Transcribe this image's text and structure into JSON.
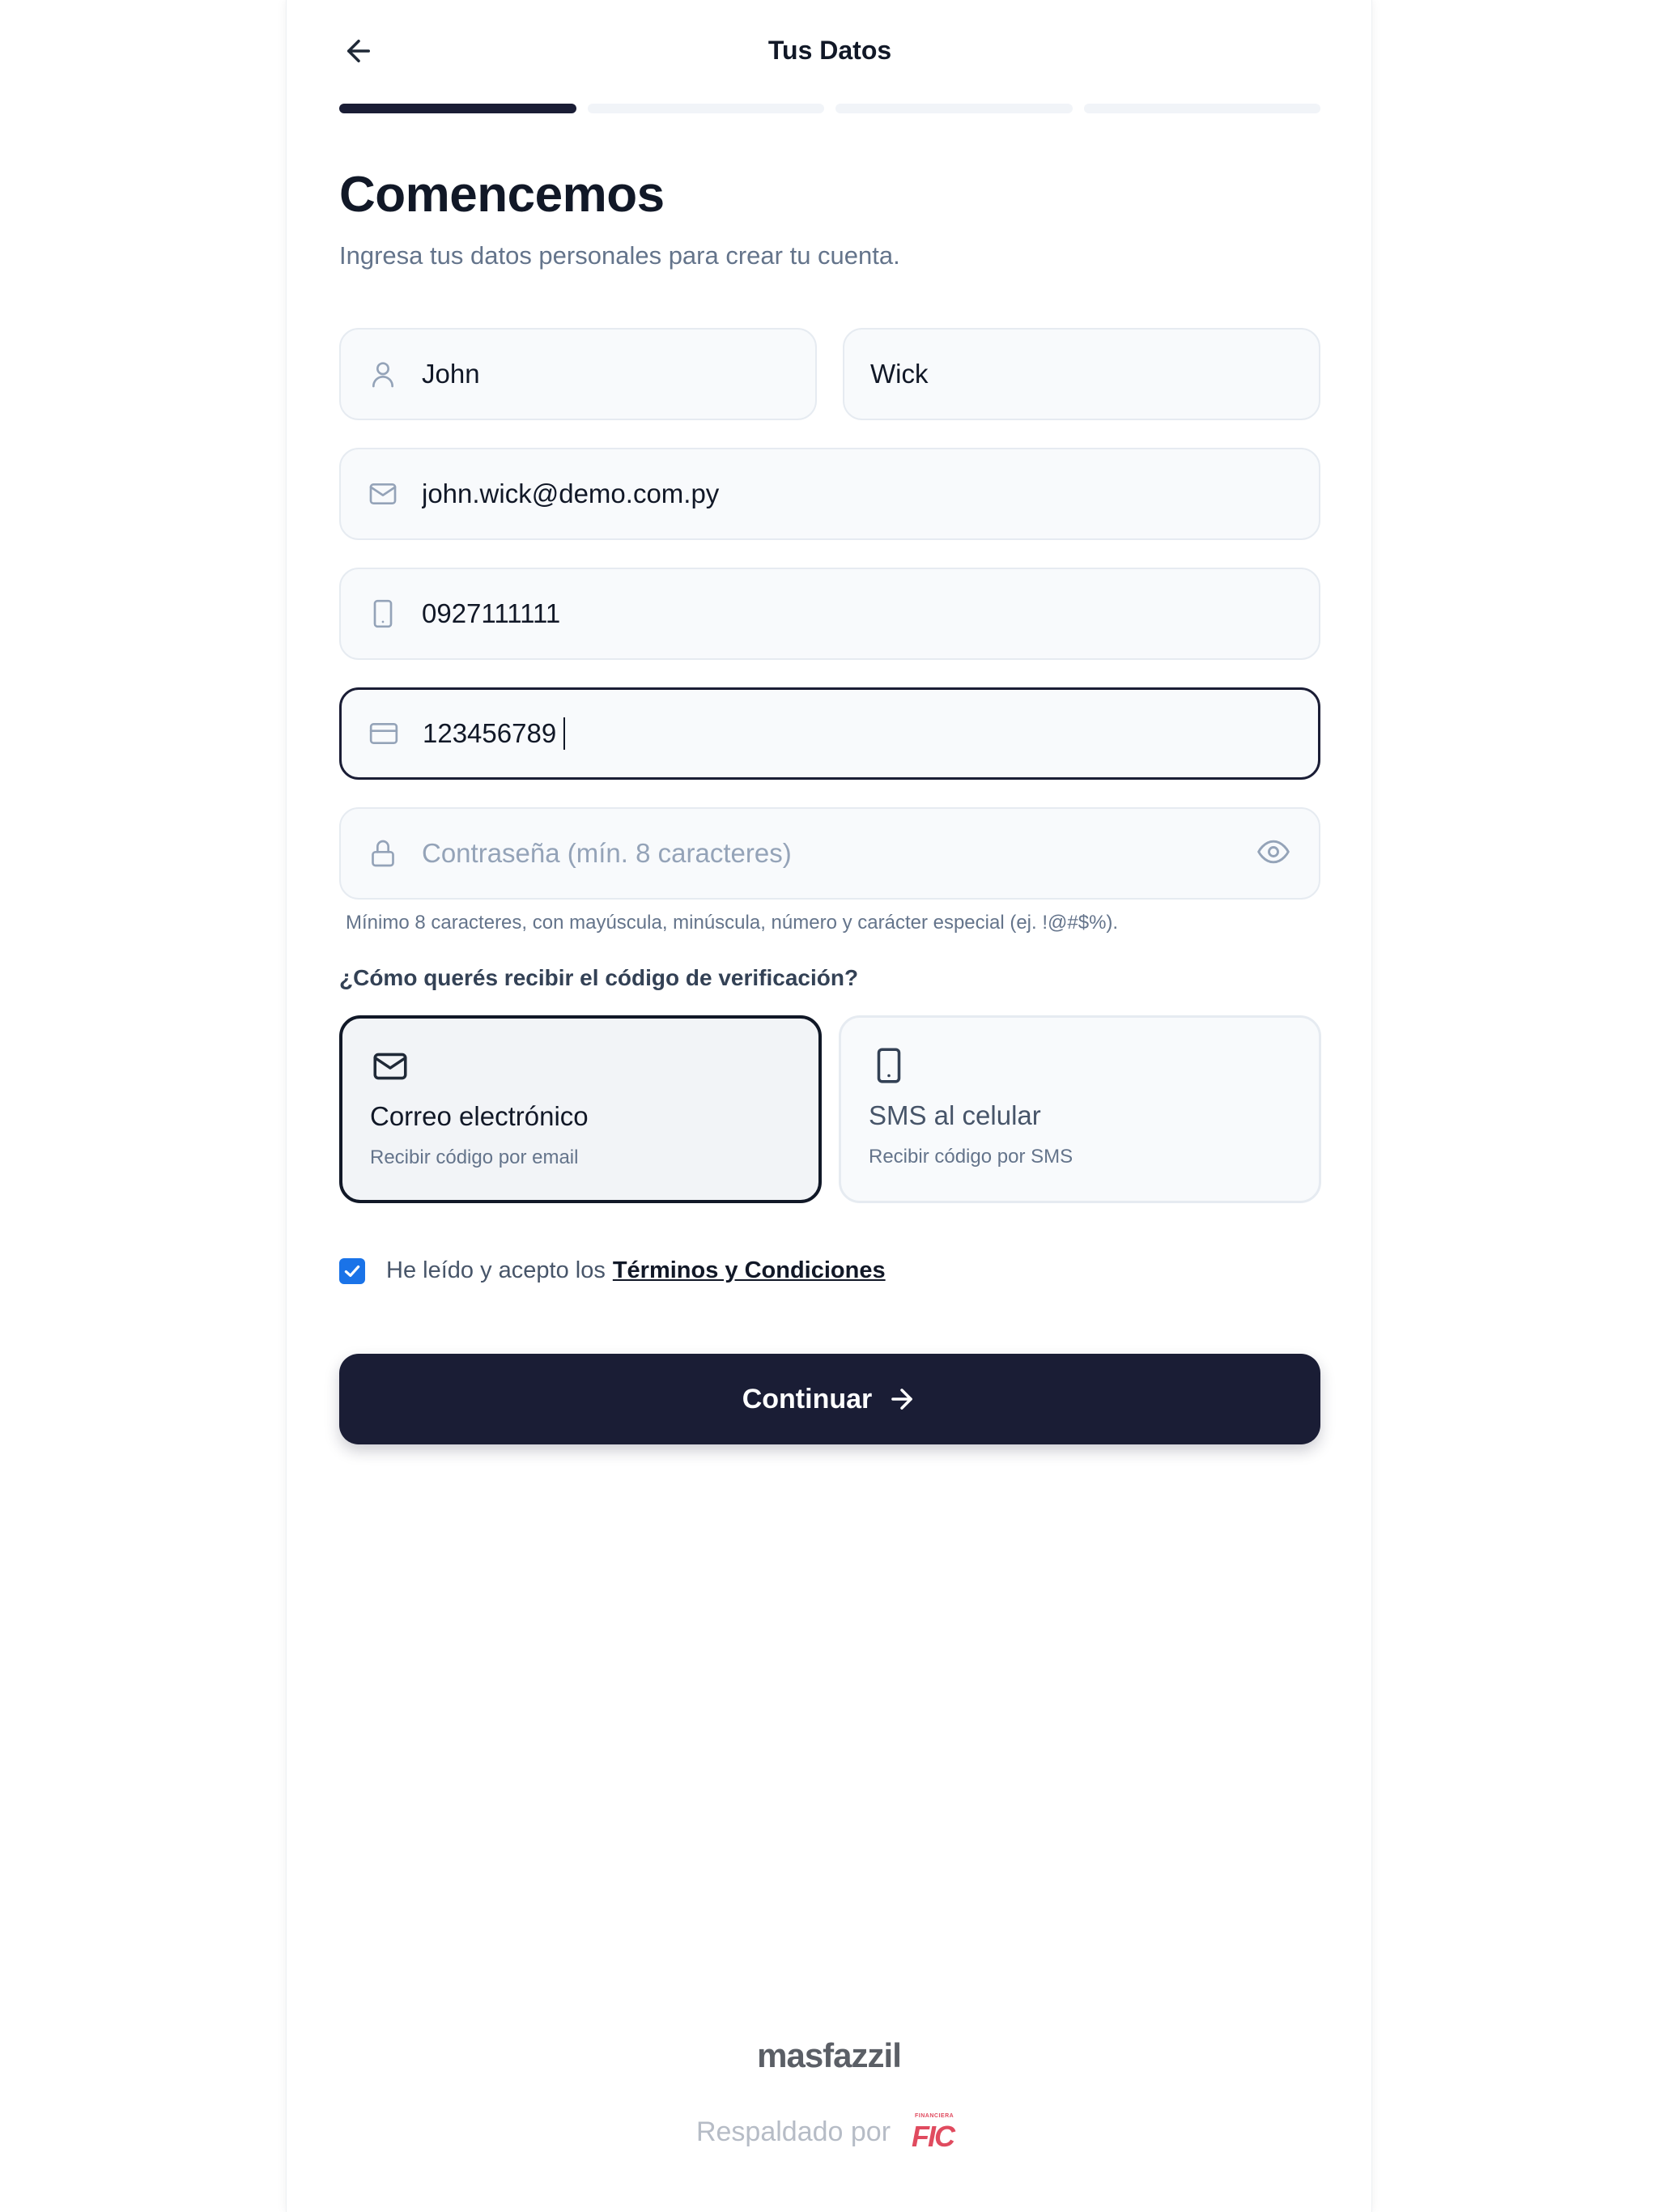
{
  "header": {
    "title": "Tus Datos",
    "back_icon": "arrow-left-icon"
  },
  "progress": {
    "current_step": 1,
    "total_steps": 4
  },
  "intro": {
    "title": "Comencemos",
    "subtitle": "Ingresa tus datos personales para crear tu cuenta."
  },
  "form": {
    "first_name": {
      "value": "John",
      "icon": "user-icon"
    },
    "last_name": {
      "value": "Wick"
    },
    "email": {
      "value": "john.wick@demo.com.py",
      "icon": "mail-icon"
    },
    "phone": {
      "value": "0927111111",
      "icon": "phone-icon"
    },
    "document": {
      "value": "123456789",
      "icon": "id-card-icon"
    },
    "password": {
      "value": "",
      "placeholder": "Contraseña (mín. 8 caracteres)",
      "icon": "lock-icon",
      "toggle_icon": "eye-icon"
    },
    "password_hint": "Mínimo 8 caracteres, con mayúscula, minúscula, número y carácter especial (ej. !@#$%)."
  },
  "verification": {
    "question": "¿Cómo querés recibir el código de verificación?",
    "options": [
      {
        "title": "Correo electrónico",
        "subtitle": "Recibir código por email",
        "icon": "mail-icon",
        "selected": true
      },
      {
        "title": "SMS al celular",
        "subtitle": "Recibir código por SMS",
        "icon": "phone-icon",
        "selected": false
      }
    ]
  },
  "terms": {
    "checked": true,
    "text": "He leído y acepto los",
    "link": "Términos y Condiciones"
  },
  "continue_button": {
    "label": "Continuar"
  },
  "footer": {
    "brand": "masfazzil",
    "backed_by": "Respaldado por",
    "partner_small": "FINANCIERA",
    "partner_main": "FIC"
  },
  "colors": {
    "primary": "#1a1d35",
    "checkbox": "#1a73e8",
    "input_bg": "#f8fafc",
    "input_border": "#e6ebf1",
    "muted_text": "#64748b",
    "partner_red": "#e04b5f"
  }
}
